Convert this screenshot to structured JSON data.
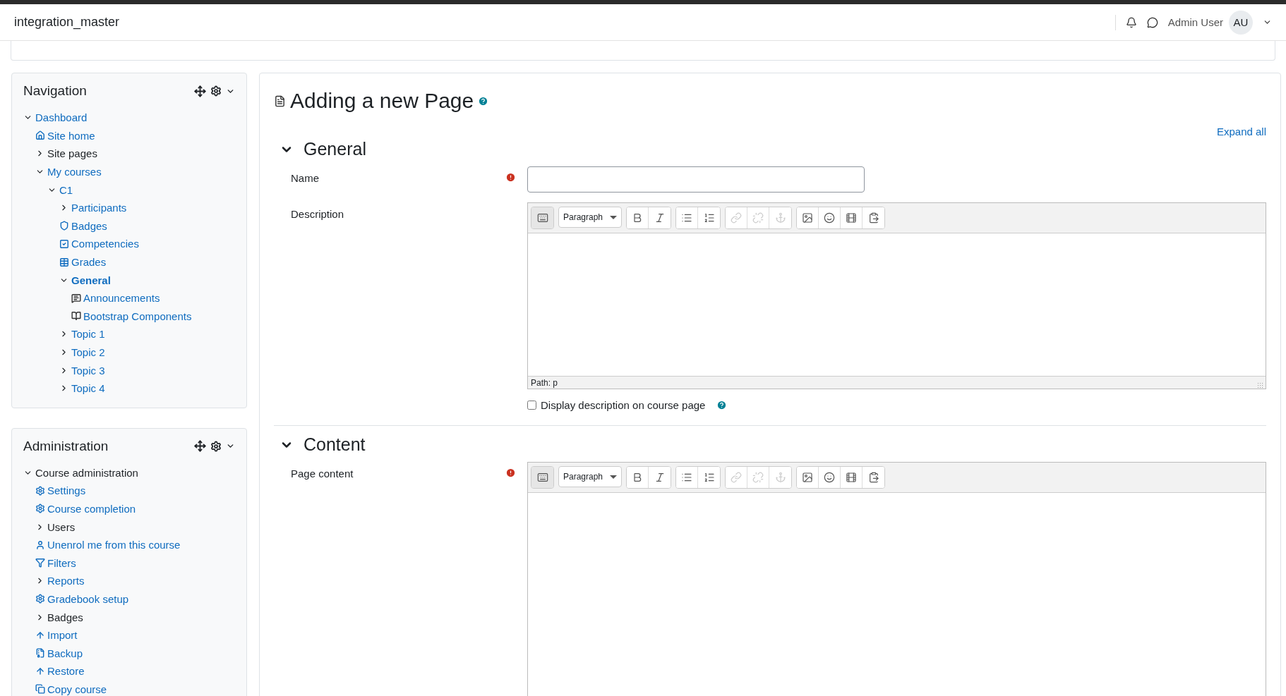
{
  "header": {
    "site_name": "integration_master",
    "user_name": "Admin User",
    "avatar_initials": "AU"
  },
  "navigation": {
    "title": "Navigation",
    "items": [
      {
        "label": "Dashboard",
        "kind": "branch",
        "expanded": true,
        "link": true,
        "selected": false,
        "children": [
          {
            "label": "Site home",
            "kind": "home",
            "link": true,
            "selected": false
          },
          {
            "label": "Site pages",
            "kind": "branch",
            "expanded": false,
            "link": false,
            "selected": false
          },
          {
            "label": "My courses",
            "kind": "branch",
            "expanded": true,
            "link": true,
            "selected": false,
            "children": [
              {
                "label": "C1",
                "kind": "branch",
                "expanded": true,
                "link": true,
                "selected": false,
                "children": [
                  {
                    "label": "Participants",
                    "kind": "branch",
                    "expanded": false,
                    "link": true,
                    "selected": false
                  },
                  {
                    "label": "Badges",
                    "kind": "badge",
                    "link": true,
                    "selected": false
                  },
                  {
                    "label": "Competencies",
                    "kind": "competency",
                    "link": true,
                    "selected": false
                  },
                  {
                    "label": "Grades",
                    "kind": "grades",
                    "link": true,
                    "selected": false
                  },
                  {
                    "label": "General",
                    "kind": "branch",
                    "expanded": true,
                    "link": true,
                    "selected": true,
                    "children": [
                      {
                        "label": "Announcements",
                        "kind": "forum",
                        "link": true,
                        "selected": false
                      },
                      {
                        "label": "Bootstrap Components",
                        "kind": "book",
                        "link": true,
                        "selected": false
                      }
                    ]
                  },
                  {
                    "label": "Topic 1",
                    "kind": "branch",
                    "expanded": false,
                    "link": true,
                    "selected": false
                  },
                  {
                    "label": "Topic 2",
                    "kind": "branch",
                    "expanded": false,
                    "link": true,
                    "selected": false
                  },
                  {
                    "label": "Topic 3",
                    "kind": "branch",
                    "expanded": false,
                    "link": true,
                    "selected": false
                  },
                  {
                    "label": "Topic 4",
                    "kind": "branch",
                    "expanded": false,
                    "link": true,
                    "selected": false
                  }
                ]
              }
            ]
          }
        ]
      }
    ]
  },
  "administration": {
    "title": "Administration",
    "items": [
      {
        "label": "Course administration",
        "kind": "branch",
        "expanded": true,
        "link": false,
        "selected": false,
        "children": [
          {
            "label": "Settings",
            "kind": "gear",
            "link": true,
            "selected": false
          },
          {
            "label": "Course completion",
            "kind": "gear",
            "link": true,
            "selected": false
          },
          {
            "label": "Users",
            "kind": "branch",
            "expanded": false,
            "link": false,
            "selected": false
          },
          {
            "label": "Unenrol me from this course",
            "kind": "user",
            "link": true,
            "selected": false
          },
          {
            "label": "Filters",
            "kind": "filter",
            "link": true,
            "selected": false
          },
          {
            "label": "Reports",
            "kind": "branch",
            "expanded": false,
            "link": true,
            "selected": false
          },
          {
            "label": "Gradebook setup",
            "kind": "gear",
            "link": true,
            "selected": false
          },
          {
            "label": "Badges",
            "kind": "branch",
            "expanded": false,
            "link": false,
            "selected": false
          },
          {
            "label": "Import",
            "kind": "import",
            "link": true,
            "selected": false
          },
          {
            "label": "Backup",
            "kind": "backup",
            "link": true,
            "selected": false
          },
          {
            "label": "Restore",
            "kind": "import",
            "link": true,
            "selected": false
          },
          {
            "label": "Copy course",
            "kind": "copy",
            "link": true,
            "selected": false
          }
        ]
      }
    ]
  },
  "page": {
    "title": "Adding a new Page",
    "expand_all": "Expand all"
  },
  "sections": [
    {
      "title": "General",
      "expanded": true,
      "fields": [
        {
          "kind": "text",
          "label": "Name",
          "required": true
        },
        {
          "kind": "editor",
          "label": "Description",
          "required": false,
          "format": "Paragraph",
          "path": "Path: p",
          "toolbar": [
            {
              "kind": "more",
              "disabled": false,
              "pressed": true
            },
            {
              "kind": "bold",
              "disabled": false,
              "pressed": false
            },
            {
              "kind": "italic",
              "disabled": false,
              "pressed": false
            },
            {
              "kind": "bullets",
              "disabled": false,
              "pressed": false
            },
            {
              "kind": "numbers",
              "disabled": false,
              "pressed": false
            },
            {
              "kind": "link",
              "disabled": true,
              "pressed": false
            },
            {
              "kind": "unlink",
              "disabled": true,
              "pressed": false
            },
            {
              "kind": "anchor",
              "disabled": true,
              "pressed": false
            },
            {
              "kind": "image",
              "disabled": false,
              "pressed": false
            },
            {
              "kind": "emoji",
              "disabled": false,
              "pressed": false
            },
            {
              "kind": "media",
              "disabled": false,
              "pressed": false
            },
            {
              "kind": "files",
              "disabled": false,
              "pressed": false
            }
          ]
        },
        {
          "kind": "checkbox",
          "label": "Display description on course page",
          "checked": false
        }
      ]
    },
    {
      "title": "Content",
      "expanded": true,
      "fields": [
        {
          "kind": "editor",
          "label": "Page content",
          "required": true,
          "format": "Paragraph",
          "toolbar": [
            {
              "kind": "more",
              "disabled": false,
              "pressed": true
            },
            {
              "kind": "bold",
              "disabled": false,
              "pressed": false
            },
            {
              "kind": "italic",
              "disabled": false,
              "pressed": false
            },
            {
              "kind": "bullets",
              "disabled": false,
              "pressed": false
            },
            {
              "kind": "numbers",
              "disabled": false,
              "pressed": false
            },
            {
              "kind": "link",
              "disabled": true,
              "pressed": false
            },
            {
              "kind": "unlink",
              "disabled": true,
              "pressed": false
            },
            {
              "kind": "anchor",
              "disabled": true,
              "pressed": false
            },
            {
              "kind": "image",
              "disabled": false,
              "pressed": false
            },
            {
              "kind": "emoji",
              "disabled": false,
              "pressed": false
            },
            {
              "kind": "media",
              "disabled": false,
              "pressed": false
            },
            {
              "kind": "files",
              "disabled": false,
              "pressed": false
            }
          ]
        }
      ]
    }
  ]
}
